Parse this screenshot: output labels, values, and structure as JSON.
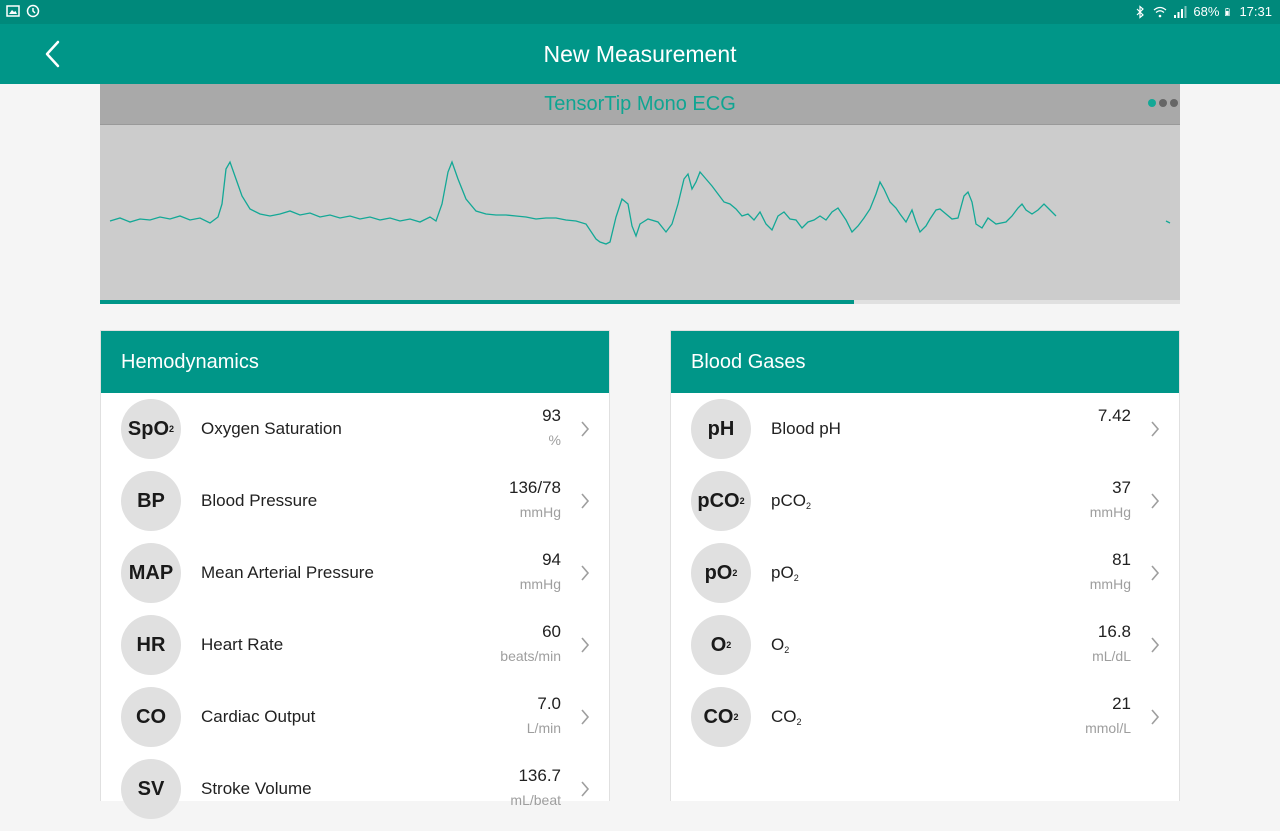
{
  "status_bar": {
    "battery": "68%",
    "time": "17:31"
  },
  "app_bar": {
    "title": "New Measurement"
  },
  "ecg": {
    "title": "TensorTip Mono ECG",
    "page_count": 3,
    "active_page": 0,
    "progress_fraction": 0.698
  },
  "hemodynamics": {
    "title": "Hemodynamics",
    "rows": [
      {
        "abbr": "SpO",
        "abbr_sub": "2",
        "label": "Oxygen Saturation",
        "value": "93",
        "unit": "%"
      },
      {
        "abbr": "BP",
        "label": "Blood Pressure",
        "value": "136/78",
        "unit": "mmHg"
      },
      {
        "abbr": "MAP",
        "label": "Mean Arterial Pressure",
        "value": "94",
        "unit": "mmHg"
      },
      {
        "abbr": "HR",
        "label": "Heart Rate",
        "value": "60",
        "unit": "beats/min"
      },
      {
        "abbr": "CO",
        "label": "Cardiac Output",
        "value": "7.0",
        "unit": "L/min"
      },
      {
        "abbr": "SV",
        "label": "Stroke Volume",
        "value": "136.7",
        "unit": "mL/beat"
      }
    ]
  },
  "blood_gases": {
    "title": "Blood Gases",
    "rows": [
      {
        "abbr": "pH",
        "label": "Blood pH",
        "value": "7.42",
        "unit": ""
      },
      {
        "abbr": "pCO",
        "abbr_sub": "2",
        "label": "pCO",
        "label_sub": "2",
        "value": "37",
        "unit": "mmHg"
      },
      {
        "abbr": "pO",
        "abbr_sub": "2",
        "label": "pO",
        "label_sub": "2",
        "value": "81",
        "unit": "mmHg"
      },
      {
        "abbr": "O",
        "abbr_sub": "2",
        "label": "O",
        "label_sub": "2",
        "value": "16.8",
        "unit": "mL/dL"
      },
      {
        "abbr": "CO",
        "abbr_sub": "2",
        "label": "CO",
        "label_sub": "2",
        "value": "21",
        "unit": "mmol/L"
      }
    ]
  },
  "colors": {
    "primary": "#009688",
    "status_bar": "#00897b",
    "ecg_trace": "#13a896"
  }
}
